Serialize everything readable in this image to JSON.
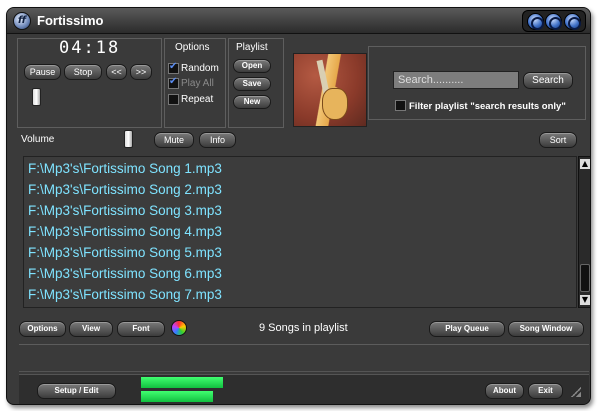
{
  "window": {
    "title": "Fortissimo"
  },
  "titlebar_icons": [
    "minimize-icon",
    "maximize-icon",
    "close-icon"
  ],
  "player": {
    "time": "04:18",
    "buttons": {
      "pause": "Pause",
      "stop": "Stop",
      "prev": "<<",
      "next": ">>"
    }
  },
  "options": {
    "header": "Options",
    "random": {
      "label": "Random",
      "checked": true
    },
    "play_all": {
      "label": "Play All",
      "checked": true,
      "disabled": true
    },
    "repeat": {
      "label": "Repeat",
      "checked": false
    }
  },
  "playlist_box": {
    "header": "Playlist",
    "open": "Open",
    "save": "Save",
    "new": "New"
  },
  "search": {
    "placeholder": "Search..........",
    "button": "Search",
    "filter_label": "Filter playlist \"search results only\"",
    "filter_checked": false
  },
  "volume": {
    "label": "Volume",
    "mute": "Mute",
    "info": "Info",
    "sort": "Sort"
  },
  "tracks": [
    "F:\\Mp3's\\Fortissimo Song 1.mp3",
    "F:\\Mp3's\\Fortissimo Song 2.mp3",
    "F:\\Mp3's\\Fortissimo Song 3.mp3",
    "F:\\Mp3's\\Fortissimo Song 4.mp3",
    "F:\\Mp3's\\Fortissimo Song 5.mp3",
    "F:\\Mp3's\\Fortissimo Song 6.mp3",
    "F:\\Mp3's\\Fortissimo Song 7.mp3"
  ],
  "toolbar": {
    "options": "Options",
    "view": "View",
    "font": "Font",
    "status": "9 Songs in playlist",
    "play_queue": "Play Queue",
    "song_window": "Song Window"
  },
  "footer": {
    "setup": "Setup / Edit",
    "about": "About",
    "exit": "Exit"
  },
  "colors": {
    "track_text": "#7fe3ff",
    "meter": "#22e050",
    "title_button": "#3e6fc7"
  }
}
